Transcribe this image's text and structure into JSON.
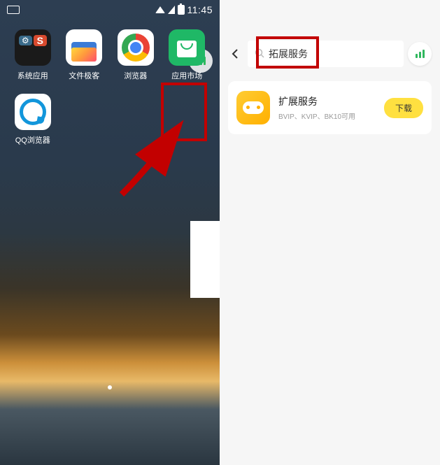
{
  "status": {
    "time": "11:45"
  },
  "apps": [
    {
      "label": "系统应用"
    },
    {
      "label": "文件极客"
    },
    {
      "label": "浏览器"
    },
    {
      "label": "应用市场"
    },
    {
      "label": "QQ浏览器"
    }
  ],
  "search": {
    "value": "拓展服务"
  },
  "result": {
    "title": "扩展服务",
    "subtitle": "BVIP、KVIP、BK10可用",
    "button": "下载"
  }
}
